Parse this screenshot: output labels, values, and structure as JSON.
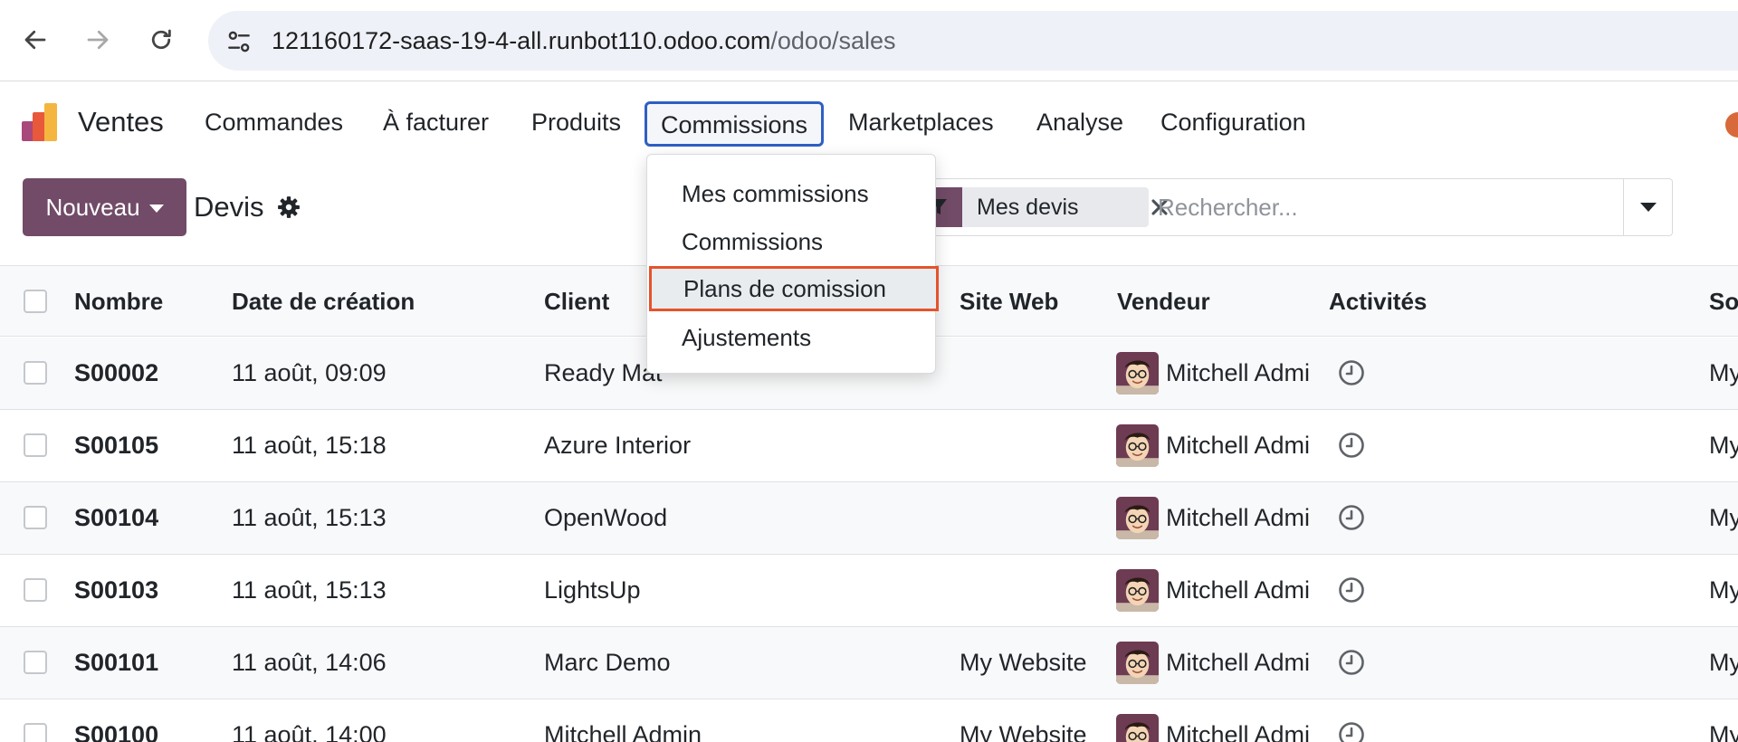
{
  "browser": {
    "url_host": "121160172-saas-19-4-all.runbot110.odoo.com",
    "url_path": "/odoo/sales"
  },
  "app": {
    "name": "Ventes",
    "menu": [
      "Commandes",
      "À facturer",
      "Produits",
      "Commissions",
      "Marketplaces",
      "Analyse",
      "Configuration"
    ],
    "active_menu": "Commissions"
  },
  "dropdown": {
    "items": [
      "Mes commissions",
      "Commissions",
      "Plans de comission",
      "Ajustements"
    ],
    "selected": "Plans de comission"
  },
  "control": {
    "new_label": "Nouveau",
    "title": "Devis",
    "facet_label": "Mes devis",
    "search_placeholder": "Rechercher..."
  },
  "list": {
    "columns": [
      "Nombre",
      "Date de création",
      "Client",
      "Site Web",
      "Vendeur",
      "Activités",
      "So"
    ],
    "rows": [
      {
        "number": "S00002",
        "date": "11 août, 09:09",
        "client": "Ready Mat",
        "website": "",
        "salesperson": "Mitchell Admi",
        "society": "My"
      },
      {
        "number": "S00105",
        "date": "11 août, 15:18",
        "client": "Azure Interior",
        "website": "",
        "salesperson": "Mitchell Admi",
        "society": "My"
      },
      {
        "number": "S00104",
        "date": "11 août, 15:13",
        "client": "OpenWood",
        "website": "",
        "salesperson": "Mitchell Admi",
        "society": "My"
      },
      {
        "number": "S00103",
        "date": "11 août, 15:13",
        "client": "LightsUp",
        "website": "",
        "salesperson": "Mitchell Admi",
        "society": "My"
      },
      {
        "number": "S00101",
        "date": "11 août, 14:06",
        "client": "Marc Demo",
        "website": "My Website",
        "salesperson": "Mitchell Admi",
        "society": "My"
      },
      {
        "number": "S00100",
        "date": "11 août, 14:00",
        "client": "Mitchell Admin",
        "website": "My Website",
        "salesperson": "Mitchell Admi",
        "society": "My"
      }
    ]
  },
  "colors": {
    "brand": "#714b67",
    "active_menu_border": "#2f5fc4",
    "highlight_border": "#e5532b"
  }
}
